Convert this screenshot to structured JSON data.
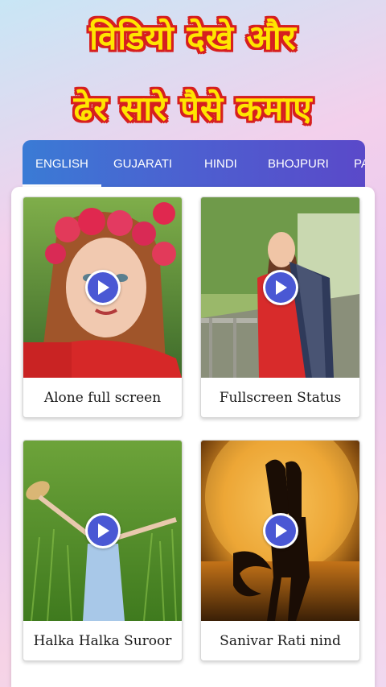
{
  "banner": {
    "line1": "विडियो देखे और",
    "line2": "ढेर सारे पैसे कमाए"
  },
  "tabs": [
    {
      "label": "ENGLISH",
      "active": true
    },
    {
      "label": "GUJARATI",
      "active": false
    },
    {
      "label": "HINDI",
      "active": false
    },
    {
      "label": "BHOJPURI",
      "active": false
    },
    {
      "label": "PA",
      "active": false
    }
  ],
  "videos": [
    {
      "title": "Alone full screen"
    },
    {
      "title": "Fullscreen Status"
    },
    {
      "title": "Halka Halka Suroor"
    },
    {
      "title": "Sanivar Rati nind"
    }
  ],
  "colors": {
    "banner_text": "#ffe600",
    "banner_outline": "#d61f1f",
    "tab_bar": "#4d5fd0",
    "play_button": "#4a58d4"
  }
}
